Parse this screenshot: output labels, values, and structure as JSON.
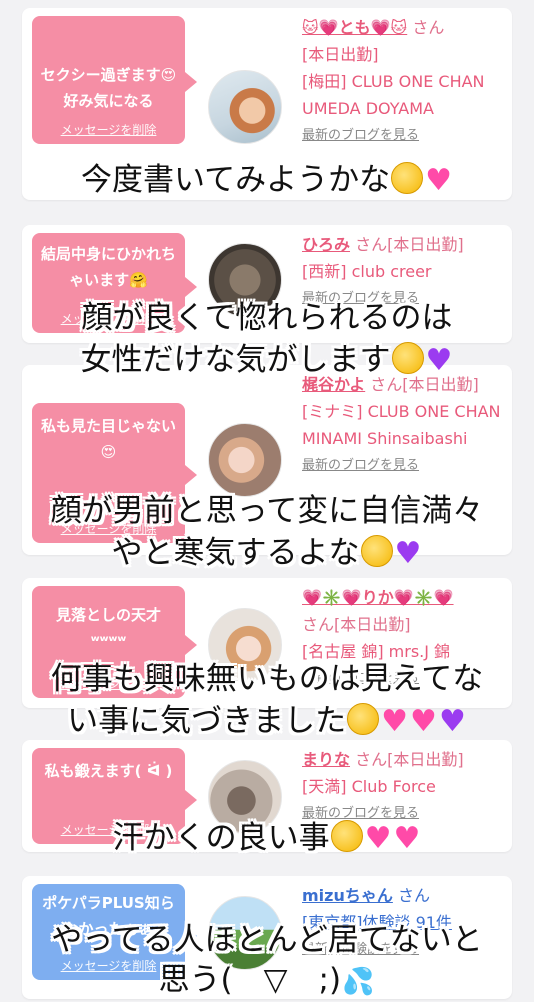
{
  "cards": [
    {
      "bubble_text": "セクシー過ぎます😍好み気になる",
      "bubble_delete": "メッセージを削除",
      "name": "🐱💗とも💗🐱",
      "san": "さん",
      "line2": "[本日出勤]",
      "area": "[梅田] CLUB ONE CHAN UMEDA DOYAMA",
      "blog": "最新のブログを見る"
    },
    {
      "bubble_text": "結局中身にひかれちゃいます🤗",
      "bubble_delete": "メッセージを削除",
      "name": "ひろみ",
      "san": "さん[本日出勤]",
      "area": "[西新] club creer",
      "blog": "最新のブログを見る"
    },
    {
      "bubble_text": "私も見た目じゃない😍",
      "bubble_delete": "メッセージを削除",
      "name": "梶谷かよ",
      "san": "さん[本日出勤]",
      "area": "[ミナミ] CLUB ONE CHAN MINAMI Shinsaibashi",
      "blog": "最新のブログを見る"
    },
    {
      "bubble_text": "見落としの天才ʷʷʷʷ",
      "bubble_delete": "メッセージを削除",
      "name": "💗✳️💗りか💗✳️💗",
      "san": "さん[本日出勤]",
      "area": "[名古屋 錦] mrs.J 錦",
      "blog": "最新のブログを見る"
    },
    {
      "bubble_text": "私も鍛えます( ᐛ )",
      "bubble_delete": "メッセージを削除",
      "name": "まりな",
      "san": "さん[本日出勤]",
      "area": "[天満] Club Force",
      "blog": "最新のブログを見る"
    },
    {
      "bubble_text": "ポケパラPLUS知らなかったぁぁ",
      "bubble_delete": "メッセージを削除",
      "name": "mizuちゃん",
      "san": "さん",
      "area": "[東京都]体験談 91件",
      "blog": "最新の体験談を見る"
    }
  ],
  "overlays": [
    "今度書いてみようかな",
    "顔が良くて惚れられるのは",
    "女性だけな気がします",
    "顔が男前と思って変に自信満々",
    "やと寒気するよな",
    "何事も興味無いものは見えてな",
    "い事に気づきました",
    "汗かくの良い事",
    "やってる人ほとんど居てないと",
    "思う(　▽　;)"
  ],
  "colors": {
    "bubble_pink": "#f58ea5",
    "bubble_blue": "#7eaef0",
    "accent_pink": "#e85a7b",
    "accent_blue": "#3a6fd0"
  }
}
